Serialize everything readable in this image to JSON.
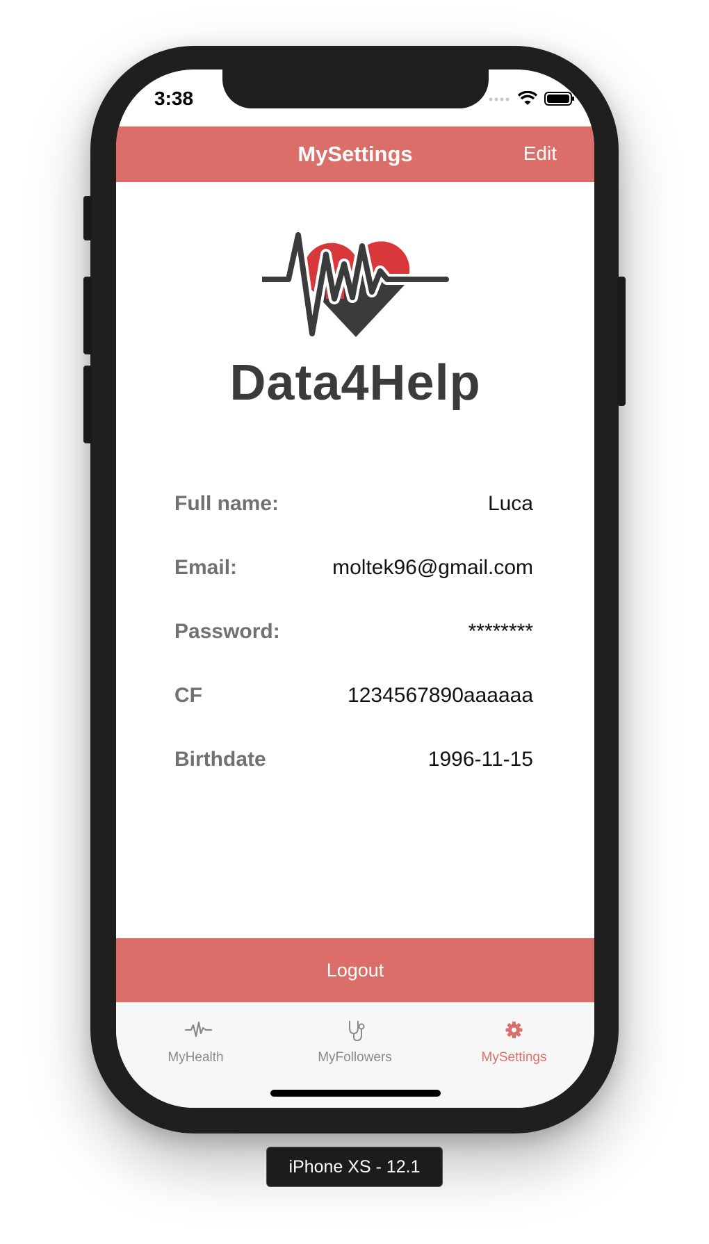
{
  "status_bar": {
    "time": "3:38"
  },
  "nav": {
    "title": "MySettings",
    "edit_label": "Edit"
  },
  "logo": {
    "text": "Data4Help"
  },
  "profile": {
    "rows": [
      {
        "label": "Full name:",
        "value": "Luca"
      },
      {
        "label": "Email:",
        "value": "moltek96@gmail.com"
      },
      {
        "label": "Password:",
        "value": "********"
      },
      {
        "label": "CF",
        "value": "1234567890aaaaaa"
      },
      {
        "label": "Birthdate",
        "value": "1996-11-15"
      }
    ]
  },
  "logout_label": "Logout",
  "tabs": [
    {
      "label": "MyHealth",
      "icon": "heartbeat-icon",
      "active": false
    },
    {
      "label": "MyFollowers",
      "icon": "stethoscope-icon",
      "active": false
    },
    {
      "label": "MySettings",
      "icon": "gear-icon",
      "active": true
    }
  ],
  "device_label": "iPhone XS - 12.1",
  "colors": {
    "accent": "#dc6e69",
    "logo_red": "#d8383a",
    "logo_dark": "#3b3b3d"
  }
}
